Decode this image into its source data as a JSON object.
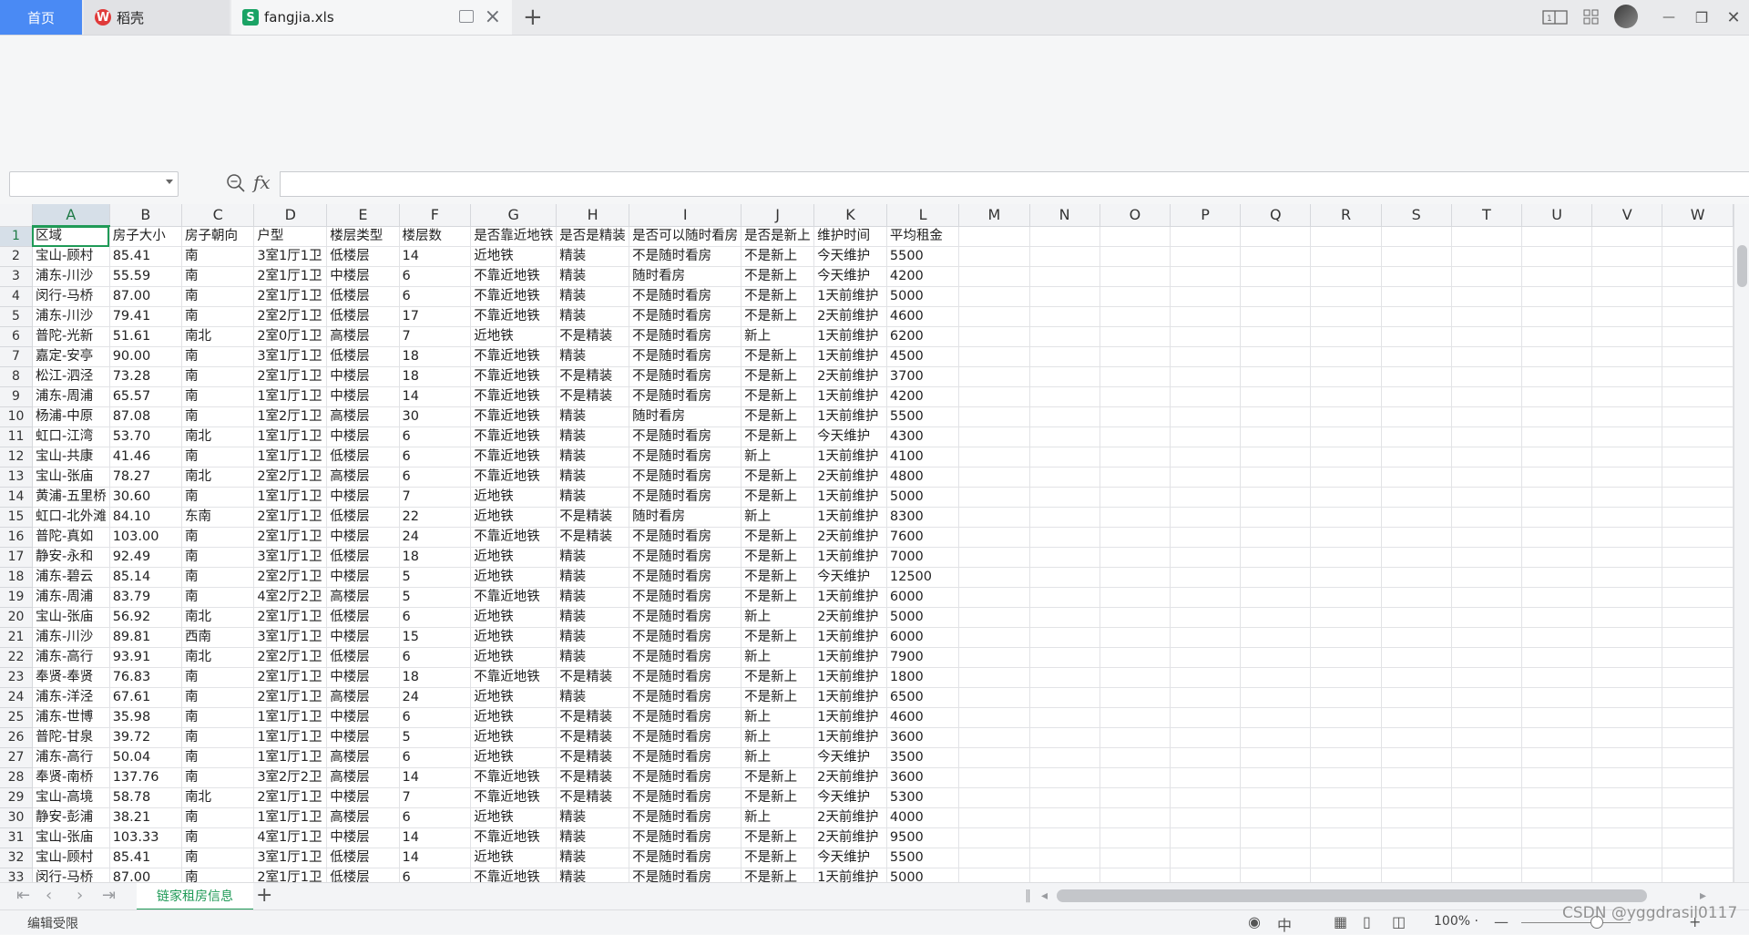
{
  "tabs": {
    "home_label": "首页",
    "daoke_label": "稻壳",
    "daoke_logo": "W",
    "file_label": "fangjia.xls",
    "file_logo": "S",
    "new_tab": "+"
  },
  "window": {
    "minimize": "—",
    "restore": "❐",
    "close": "✕"
  },
  "formula_bar": {
    "fx_label": "fx",
    "name_box_value": "",
    "formula_value": ""
  },
  "columns": [
    "A",
    "B",
    "C",
    "D",
    "E",
    "F",
    "G",
    "H",
    "I",
    "J",
    "K",
    "L",
    "M",
    "N",
    "O",
    "P",
    "Q",
    "R",
    "S",
    "T",
    "U",
    "V",
    "W"
  ],
  "header_row": [
    "区域",
    "房子大小",
    "房子朝向",
    "户型",
    "楼层类型",
    "楼层数",
    "是否靠近地铁",
    "是否是精装",
    "是否可以随时看房",
    "是否是新上",
    "维护时间",
    "平均租金"
  ],
  "rows": [
    [
      "宝山-顾村",
      "85.41",
      "南",
      "3室1厅1卫",
      "低楼层",
      "14",
      "近地铁",
      "精装",
      "不是随时看房",
      "不是新上",
      "今天维护",
      "5500"
    ],
    [
      "浦东-川沙",
      "55.59",
      "南",
      "2室1厅1卫",
      "中楼层",
      "6",
      "不靠近地铁",
      "精装",
      "随时看房",
      "不是新上",
      "今天维护",
      "4200"
    ],
    [
      "闵行-马桥",
      "87.00",
      "南",
      "2室1厅1卫",
      "低楼层",
      "6",
      "不靠近地铁",
      "精装",
      "不是随时看房",
      "不是新上",
      "1天前维护",
      "5000"
    ],
    [
      "浦东-川沙",
      "79.41",
      "南",
      "2室2厅1卫",
      "低楼层",
      "17",
      "不靠近地铁",
      "精装",
      "不是随时看房",
      "不是新上",
      "2天前维护",
      "4600"
    ],
    [
      "普陀-光新",
      "51.61",
      "南北",
      "2室0厅1卫",
      "高楼层",
      "7",
      "近地铁",
      "不是精装",
      "不是随时看房",
      "新上",
      "1天前维护",
      "6200"
    ],
    [
      "嘉定-安亭",
      "90.00",
      "南",
      "3室1厅1卫",
      "低楼层",
      "18",
      "不靠近地铁",
      "精装",
      "不是随时看房",
      "不是新上",
      "1天前维护",
      "4500"
    ],
    [
      "松江-泗泾",
      "73.28",
      "南",
      "2室1厅1卫",
      "中楼层",
      "18",
      "不靠近地铁",
      "不是精装",
      "不是随时看房",
      "不是新上",
      "2天前维护",
      "3700"
    ],
    [
      "浦东-周浦",
      "65.57",
      "南",
      "1室1厅1卫",
      "中楼层",
      "14",
      "不靠近地铁",
      "不是精装",
      "不是随时看房",
      "不是新上",
      "1天前维护",
      "4200"
    ],
    [
      "杨浦-中原",
      "87.08",
      "南",
      "1室2厅1卫",
      "高楼层",
      "30",
      "不靠近地铁",
      "精装",
      "随时看房",
      "不是新上",
      "1天前维护",
      "5500"
    ],
    [
      "虹口-江湾",
      "53.70",
      "南北",
      "1室1厅1卫",
      "中楼层",
      "6",
      "不靠近地铁",
      "精装",
      "不是随时看房",
      "不是新上",
      "今天维护",
      "4300"
    ],
    [
      "宝山-共康",
      "41.46",
      "南",
      "1室1厅1卫",
      "低楼层",
      "6",
      "不靠近地铁",
      "精装",
      "不是随时看房",
      "新上",
      "1天前维护",
      "4100"
    ],
    [
      "宝山-张庙",
      "78.27",
      "南北",
      "2室2厅1卫",
      "高楼层",
      "6",
      "不靠近地铁",
      "精装",
      "不是随时看房",
      "不是新上",
      "2天前维护",
      "4800"
    ],
    [
      "黄浦-五里桥",
      "30.60",
      "南",
      "1室1厅1卫",
      "中楼层",
      "7",
      "近地铁",
      "精装",
      "不是随时看房",
      "不是新上",
      "1天前维护",
      "5000"
    ],
    [
      "虹口-北外滩",
      "84.10",
      "东南",
      "2室1厅1卫",
      "低楼层",
      "22",
      "近地铁",
      "不是精装",
      "随时看房",
      "新上",
      "1天前维护",
      "8300"
    ],
    [
      "普陀-真如",
      "103.00",
      "南",
      "2室1厅1卫",
      "中楼层",
      "24",
      "不靠近地铁",
      "不是精装",
      "不是随时看房",
      "不是新上",
      "2天前维护",
      "7600"
    ],
    [
      "静安-永和",
      "92.49",
      "南",
      "3室1厅1卫",
      "低楼层",
      "18",
      "近地铁",
      "精装",
      "不是随时看房",
      "不是新上",
      "1天前维护",
      "7000"
    ],
    [
      "浦东-碧云",
      "85.14",
      "南",
      "2室2厅1卫",
      "中楼层",
      "5",
      "近地铁",
      "精装",
      "不是随时看房",
      "不是新上",
      "今天维护",
      "12500"
    ],
    [
      "浦东-周浦",
      "83.79",
      "南",
      "4室2厅2卫",
      "高楼层",
      "5",
      "不靠近地铁",
      "精装",
      "不是随时看房",
      "不是新上",
      "1天前维护",
      "6000"
    ],
    [
      "宝山-张庙",
      "56.92",
      "南北",
      "2室1厅1卫",
      "低楼层",
      "6",
      "近地铁",
      "精装",
      "不是随时看房",
      "新上",
      "2天前维护",
      "5000"
    ],
    [
      "浦东-川沙",
      "89.81",
      "西南",
      "3室1厅1卫",
      "中楼层",
      "15",
      "近地铁",
      "精装",
      "不是随时看房",
      "不是新上",
      "1天前维护",
      "6000"
    ],
    [
      "浦东-高行",
      "93.91",
      "南北",
      "2室2厅1卫",
      "低楼层",
      "6",
      "近地铁",
      "精装",
      "不是随时看房",
      "新上",
      "1天前维护",
      "7900"
    ],
    [
      "奉贤-奉贤",
      "76.83",
      "南",
      "2室1厅1卫",
      "中楼层",
      "18",
      "不靠近地铁",
      "不是精装",
      "不是随时看房",
      "不是新上",
      "1天前维护",
      "1800"
    ],
    [
      "浦东-洋泾",
      "67.61",
      "南",
      "2室1厅1卫",
      "高楼层",
      "24",
      "近地铁",
      "精装",
      "不是随时看房",
      "不是新上",
      "1天前维护",
      "6500"
    ],
    [
      "浦东-世博",
      "35.98",
      "南",
      "1室1厅1卫",
      "中楼层",
      "6",
      "近地铁",
      "不是精装",
      "不是随时看房",
      "新上",
      "1天前维护",
      "4600"
    ],
    [
      "普陀-甘泉",
      "39.72",
      "南",
      "1室1厅1卫",
      "中楼层",
      "5",
      "近地铁",
      "不是精装",
      "不是随时看房",
      "新上",
      "1天前维护",
      "3600"
    ],
    [
      "浦东-高行",
      "50.04",
      "南",
      "1室1厅1卫",
      "高楼层",
      "6",
      "近地铁",
      "不是精装",
      "不是随时看房",
      "新上",
      "今天维护",
      "3500"
    ],
    [
      "奉贤-南桥",
      "137.76",
      "南",
      "3室2厅2卫",
      "高楼层",
      "14",
      "不靠近地铁",
      "不是精装",
      "不是随时看房",
      "不是新上",
      "2天前维护",
      "3600"
    ],
    [
      "宝山-高境",
      "58.78",
      "南北",
      "2室1厅1卫",
      "中楼层",
      "7",
      "不靠近地铁",
      "不是精装",
      "不是随时看房",
      "不是新上",
      "今天维护",
      "5300"
    ],
    [
      "静安-彭浦",
      "38.21",
      "南",
      "1室1厅1卫",
      "高楼层",
      "6",
      "近地铁",
      "精装",
      "不是随时看房",
      "新上",
      "2天前维护",
      "4000"
    ],
    [
      "宝山-张庙",
      "103.33",
      "南",
      "4室1厅1卫",
      "中楼层",
      "14",
      "不靠近地铁",
      "精装",
      "不是随时看房",
      "不是新上",
      "2天前维护",
      "9500"
    ],
    [
      "宝山-顾村",
      "85.41",
      "南",
      "3室1厅1卫",
      "低楼层",
      "14",
      "近地铁",
      "精装",
      "不是随时看房",
      "不是新上",
      "今天维护",
      "5500"
    ],
    [
      "闵行-马桥",
      "87.00",
      "南",
      "2室1厅1卫",
      "低楼层",
      "6",
      "不靠近地铁",
      "精装",
      "不是随时看房",
      "不是新上",
      "1天前维护",
      "5000"
    ]
  ],
  "sheet_tabs": [
    "链家租房信息"
  ],
  "add_sheet": "+",
  "status": {
    "left_text": "编辑受限",
    "zoom": "100% ·",
    "minus": "—",
    "plus": "+"
  },
  "watermark": "CSDN @yggdrasil0117"
}
